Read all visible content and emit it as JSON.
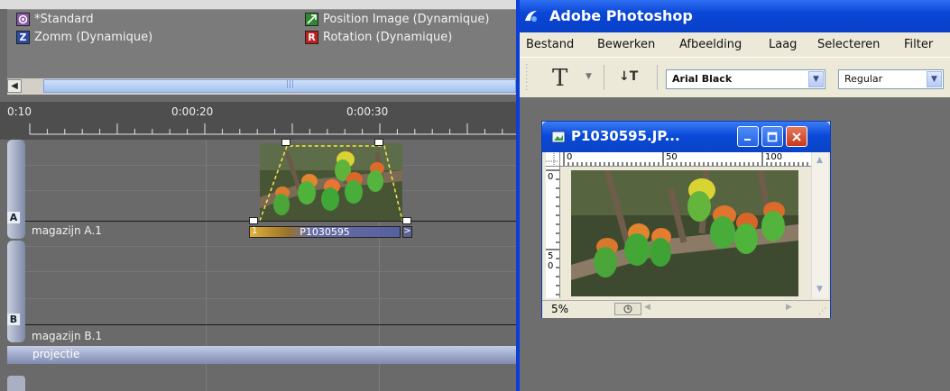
{
  "editor": {
    "effects": [
      {
        "icon": "standard-effect-icon",
        "label": "*Standard"
      },
      {
        "icon": "zoom-effect-icon",
        "label": "Zomm (Dynamique)"
      },
      {
        "icon": "position-effect-icon",
        "label": "Position Image (Dynamique)"
      },
      {
        "icon": "rotation-effect-icon",
        "label": "Rotation (Dynamique)"
      }
    ],
    "effect_icon_glyphs": {
      "zoom": "Z",
      "rotation": "R"
    },
    "timecodes": [
      "0:10",
      "0:00:20",
      "0:00:30"
    ],
    "tracks": [
      {
        "letter": "A",
        "name": "magazijn A.1"
      },
      {
        "letter": "B",
        "name": "magazijn B.1"
      }
    ],
    "projection_label": "projectie",
    "clip": {
      "name": "P1030595",
      "start_marker": "1",
      "end_marker": ">"
    }
  },
  "photoshop": {
    "title": "Adobe Photoshop",
    "menu": [
      "Bestand",
      "Bewerken",
      "Afbeelding",
      "Laag",
      "Selecteren",
      "Filter"
    ],
    "toolbar": {
      "type_tool_glyph": "T",
      "font_family": "Arial Black",
      "font_style": "Regular"
    },
    "document": {
      "title": "P1030595.JP...",
      "zoom": "5%",
      "ruler_h": [
        "0",
        "50",
        "100"
      ],
      "ruler_v": [
        "0",
        "5",
        "0"
      ]
    }
  },
  "colors": {
    "xp_blue": "#0a46d6",
    "xp_menu_bg": "#ece9d8",
    "timeline_bg": "#6a6a6a"
  }
}
